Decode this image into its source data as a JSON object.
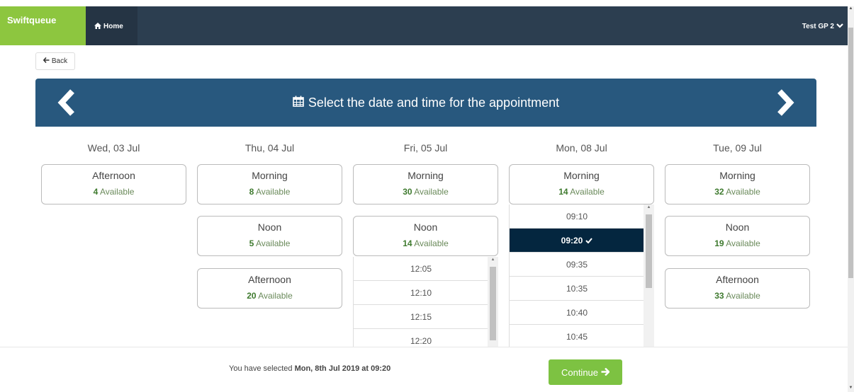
{
  "nav": {
    "brand": "Swiftqueue",
    "home_label": "Home",
    "user_label": "Test GP 2"
  },
  "back_label": "Back",
  "header": {
    "title": "Select the date and time for the appointment"
  },
  "days": [
    {
      "label": "Wed, 03 Jul",
      "slots": [
        {
          "name": "Afternoon",
          "count": "4",
          "available_text": "Available"
        }
      ]
    },
    {
      "label": "Thu, 04 Jul",
      "slots": [
        {
          "name": "Morning",
          "count": "8",
          "available_text": "Available"
        },
        {
          "name": "Noon",
          "count": "5",
          "available_text": "Available"
        },
        {
          "name": "Afternoon",
          "count": "20",
          "available_text": "Available"
        }
      ]
    },
    {
      "label": "Fri, 05 Jul",
      "slots": [
        {
          "name": "Morning",
          "count": "30",
          "available_text": "Available"
        },
        {
          "name": "Noon",
          "count": "14",
          "available_text": "Available"
        }
      ],
      "times": [
        "12:05",
        "12:10",
        "12:15",
        "12:20"
      ]
    },
    {
      "label": "Mon, 08 Jul",
      "slots": [
        {
          "name": "Morning",
          "count": "14",
          "available_text": "Available"
        }
      ],
      "times": [
        "09:10",
        "09:20",
        "09:35",
        "10:35",
        "10:40",
        "10:45"
      ],
      "selected_time_index": 1
    },
    {
      "label": "Tue, 09 Jul",
      "slots": [
        {
          "name": "Morning",
          "count": "32",
          "available_text": "Available"
        },
        {
          "name": "Noon",
          "count": "19",
          "available_text": "Available"
        },
        {
          "name": "Afternoon",
          "count": "33",
          "available_text": "Available"
        }
      ]
    }
  ],
  "footer": {
    "prefix": "You have selected",
    "selection": "Mon, 8th Jul 2019 at 09:20",
    "continue_label": "Continue"
  },
  "colors": {
    "brand": "#8dc63f",
    "navbar": "#2c3e50",
    "header": "#28587e",
    "selected": "#04263f",
    "continue": "#7dc242",
    "available_count": "#3e7a2e"
  },
  "icons": {
    "home": "home-icon",
    "user_menu": "chevron-down-icon",
    "back": "arrow-left-icon",
    "calendar": "calendar-icon",
    "prev": "chevron-left-icon",
    "next": "chevron-right-icon",
    "selected": "check-icon",
    "continue": "arrow-right-icon"
  }
}
